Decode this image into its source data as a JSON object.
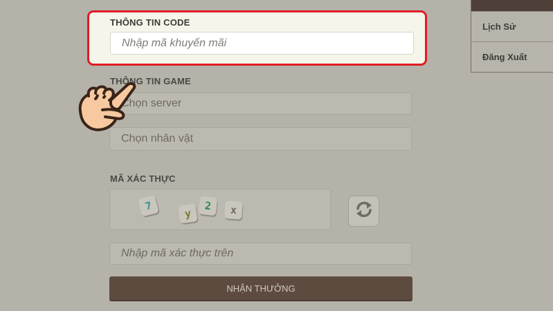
{
  "code_section": {
    "label": "THÔNG TIN CODE",
    "input_placeholder": "Nhập mã khuyến mãi"
  },
  "game_section": {
    "label": "THÔNG TIN GAME",
    "server_select": "Chọn server",
    "character_select": "Chọn nhân vật"
  },
  "captcha_section": {
    "label": "MÃ XÁC THỰC",
    "characters": [
      "7",
      "y",
      "2",
      "x"
    ],
    "input_placeholder": "Nhập mã xác thực trên",
    "refresh_icon": "refresh-icon"
  },
  "submit_button": {
    "label": "NHẬN THƯỞNG"
  },
  "side_menu": {
    "items": [
      {
        "label": "Lịch Sử"
      },
      {
        "label": "Đăng Xuất"
      }
    ]
  },
  "colors": {
    "highlight_border": "#e01b24",
    "button_bg": "#5e4b40",
    "overlay_bg": "#b5b2a9"
  },
  "pointer_icon": "hand-pointer-icon"
}
